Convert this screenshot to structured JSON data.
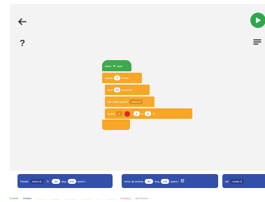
{
  "nav": {
    "help_label": "?"
  },
  "script": {
    "hat": {
      "label": "when",
      "flag_text": "clicked",
      "suffix": "start"
    },
    "b2": {
      "pre": "repeat",
      "val": "2",
      "post": "times"
    },
    "b3": {
      "pre": "wait",
      "val": "10",
      "post": "seconds"
    },
    "b4": {
      "pre": "set motor speed",
      "dd": "motor A"
    },
    "b5": {
      "pre": "motor",
      "dd": "A",
      "mid": "to",
      "val1": "2",
      "sep": "to",
      "val2": "0",
      "post": "%"
    }
  },
  "palette": {
    "block1": {
      "pre": "Rotate",
      "dd": "motor A",
      "val1": "50",
      "mid": "deg",
      "val2": "400",
      "post": "speed"
    },
    "block2": {
      "pre": "drive all motors",
      "val1": "50",
      "mid": "deg",
      "val2": "100",
      "post": "speed"
    },
    "block3": {
      "pre": "set",
      "dd": "motor A"
    }
  },
  "categories": [
    {
      "label": "Events",
      "color": "#2ca84a"
    },
    {
      "label": "Motion",
      "color": "#3350a8"
    },
    {
      "label": "",
      "color": "#f4d16a"
    },
    {
      "label": "",
      "color": "#f2b27a"
    },
    {
      "label": "",
      "color": "#e8b4dc"
    },
    {
      "label": "",
      "color": "#f4d16a"
    },
    {
      "label": "",
      "color": "#f4c3d8"
    },
    {
      "label": "",
      "color": "#9fd6e6"
    },
    {
      "label": "Sensing",
      "color": "#e66b8a"
    },
    {
      "label": "My blocks",
      "color": "#999999"
    }
  ],
  "colors": {
    "go_button": "#2ca84a",
    "motion_block": "#3350a8",
    "event_block": "#3ea84b",
    "control_block": "#f7a725"
  }
}
